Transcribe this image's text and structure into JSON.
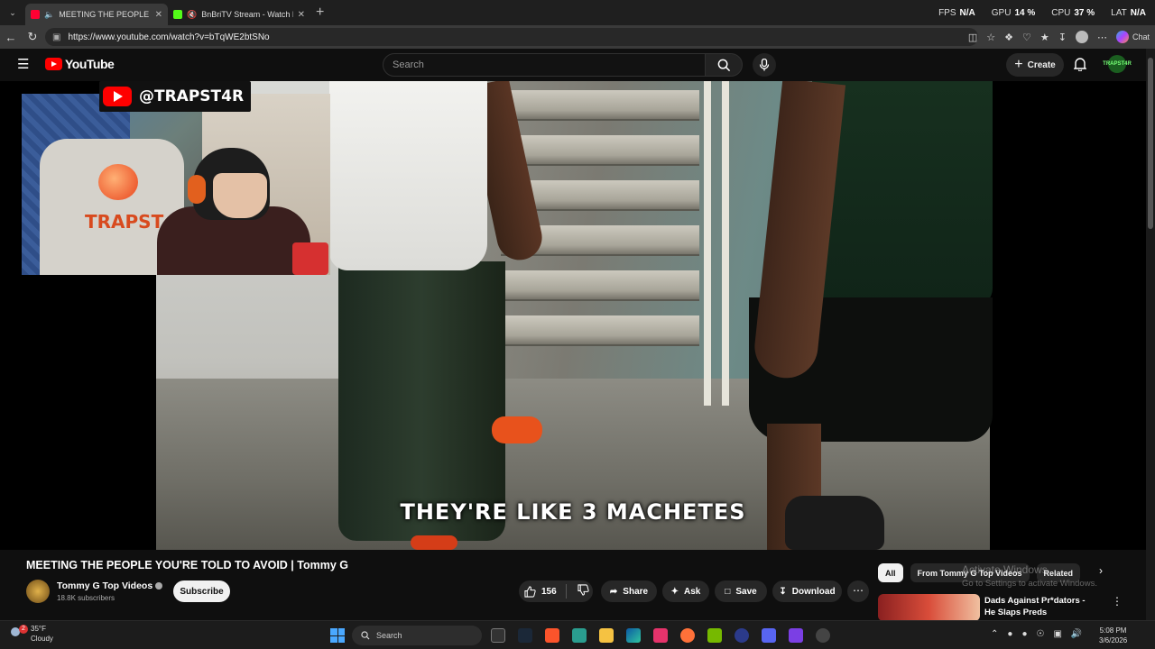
{
  "browser": {
    "tabs": [
      {
        "title": "MEETING THE PEOPLE YOU'R",
        "active": true,
        "favicon_color": "#ff0033"
      },
      {
        "title": "BnBriTV Stream - Watch Live o",
        "active": false,
        "favicon_color": "#53fc18"
      }
    ],
    "url": "https://www.youtube.com/watch?v=bTqWE2btSNo",
    "chat_label": "Chat",
    "stats": [
      {
        "label": "FPS",
        "value": "N/A"
      },
      {
        "label": "GPU",
        "value": "14 %"
      },
      {
        "label": "CPU",
        "value": "37 %"
      },
      {
        "label": "LAT",
        "value": "N/A"
      }
    ]
  },
  "youtube": {
    "logo_text": "YouTube",
    "search_placeholder": "Search",
    "create_label": "Create",
    "avatar_text": "TRAPST4R"
  },
  "video": {
    "overlay_handle": "@TRAPST4R",
    "cam_shirt_text": "TRAPST",
    "subtitle": "THEY'RE LIKE 3 MACHETES",
    "title": "MEETING THE PEOPLE YOU'RE TOLD TO AVOID | Tommy G",
    "channel_name": "Tommy G Top Videos",
    "subscribers": "18.8K subscribers",
    "subscribe_label": "Subscribe",
    "likes": "156",
    "actions": {
      "share": "Share",
      "ask": "Ask",
      "save": "Save",
      "download": "Download"
    }
  },
  "sidebar": {
    "chips": [
      "All",
      "From Tommy G Top Videos",
      "Related"
    ],
    "rec_title": "Dads Against Pr*dators - He Slaps Preds"
  },
  "watermark": {
    "line1": "Activate Windows",
    "line2": "Go to Settings to activate Windows."
  },
  "taskbar": {
    "weather_temp": "35°F",
    "weather_desc": "Cloudy",
    "weather_badge": "2",
    "search_label": "Search",
    "time": "5:08 PM",
    "date": "3/6/2026"
  }
}
